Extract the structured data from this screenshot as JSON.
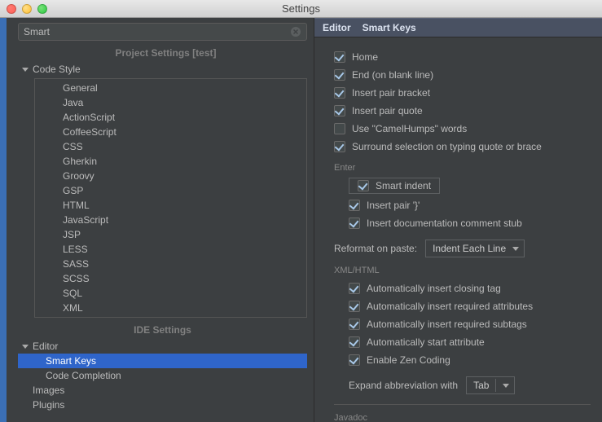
{
  "window": {
    "title": "Settings"
  },
  "search": {
    "value": "Smart"
  },
  "sections": {
    "project": "Project Settings [test]",
    "ide": "IDE Settings"
  },
  "tree": {
    "codeStyle": {
      "label": "Code Style",
      "items": [
        "General",
        "Java",
        "ActionScript",
        "CoffeeScript",
        "CSS",
        "Gherkin",
        "Groovy",
        "GSP",
        "HTML",
        "JavaScript",
        "JSP",
        "LESS",
        "SASS",
        "SCSS",
        "SQL",
        "XML"
      ]
    },
    "editor": {
      "label": "Editor",
      "items": [
        "Smart Keys",
        "Code Completion"
      ]
    },
    "images": "Images",
    "plugins": "Plugins"
  },
  "breadcrumb": {
    "a": "Editor",
    "b": "Smart Keys"
  },
  "form": {
    "home": "Home",
    "end": "End (on blank line)",
    "insertBracket": "Insert pair bracket",
    "insertQuote": "Insert pair quote",
    "camelHumps": "Use \"CamelHumps\" words",
    "surround": "Surround selection on typing quote or brace",
    "enterLabel": "Enter",
    "smartIndent": "Smart indent",
    "insertPairBrace": "Insert pair '}'",
    "insertDoc": "Insert documentation comment stub",
    "reformatLabel": "Reformat on paste:",
    "reformatValue": "Indent Each Line",
    "xmlLabel": "XML/HTML",
    "autoCloseTag": "Automatically insert closing tag",
    "autoReqAttr": "Automatically insert required attributes",
    "autoReqSub": "Automatically insert required subtags",
    "autoStartAttr": "Automatically start attribute",
    "enableZen": "Enable Zen Coding",
    "expandLabel": "Expand abbreviation with",
    "expandValue": "Tab",
    "javadocLabel": "Javadoc"
  }
}
